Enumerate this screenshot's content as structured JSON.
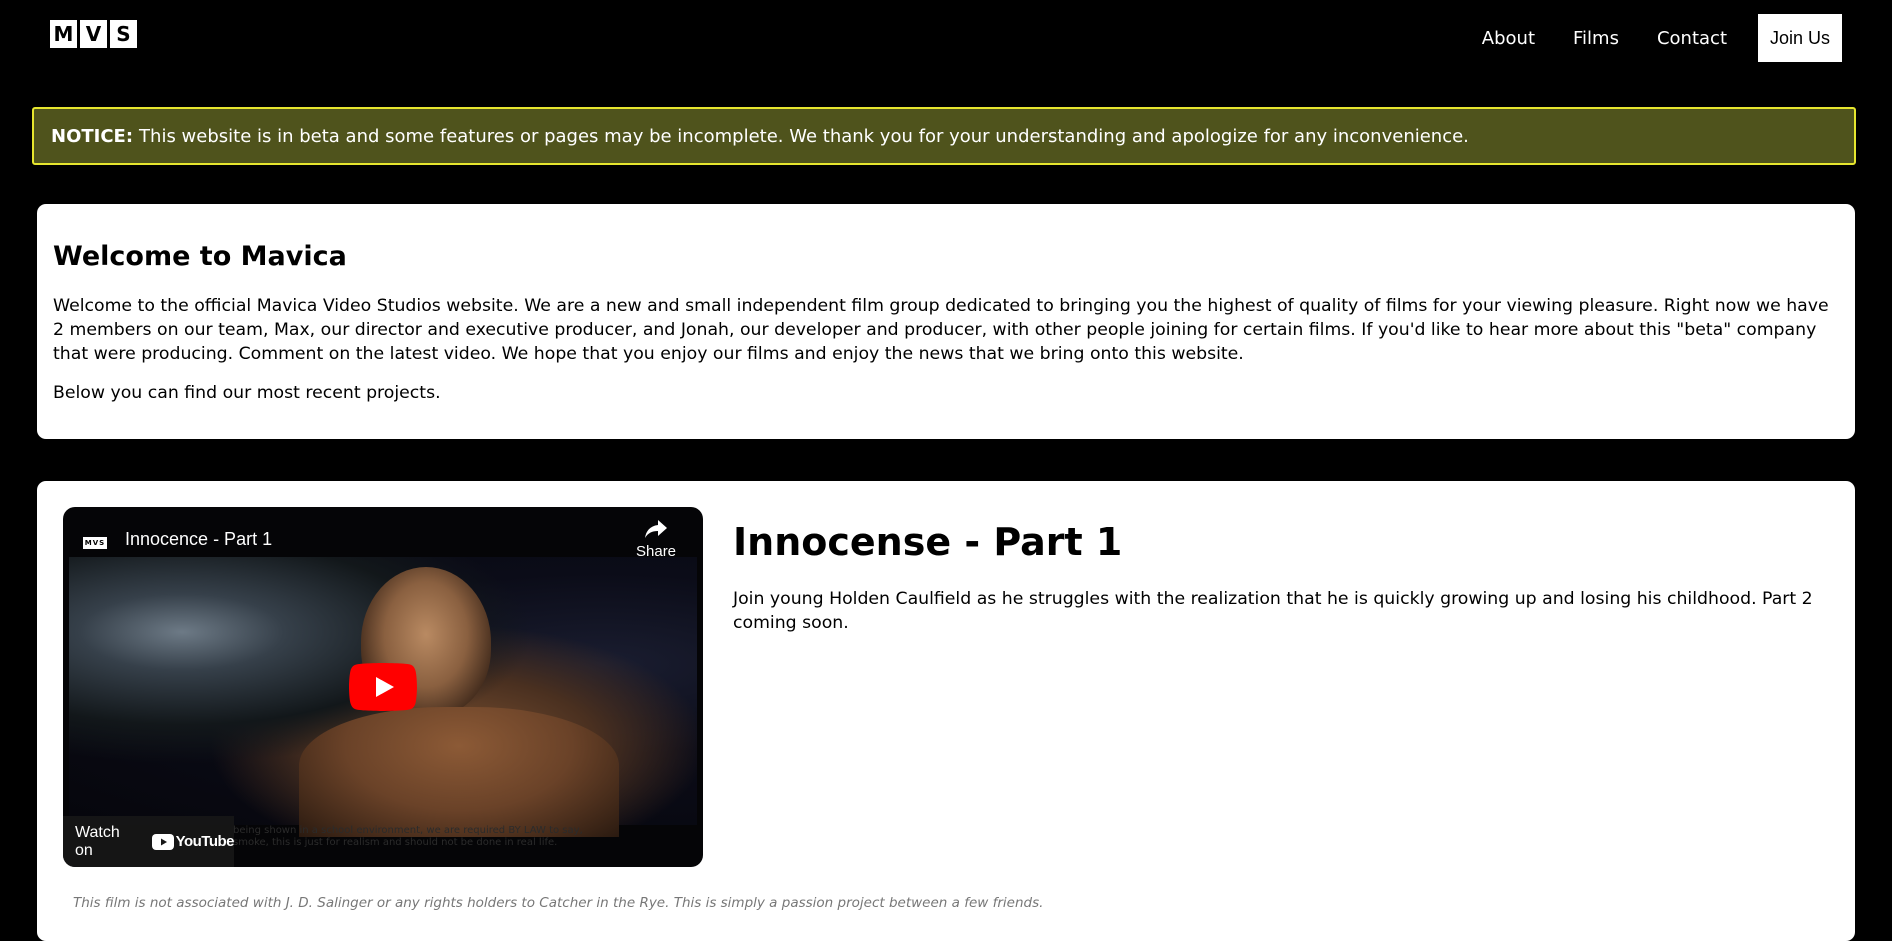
{
  "header": {
    "logo_letters": [
      "M",
      "V",
      "S"
    ],
    "nav": {
      "about": "About",
      "films": "Films",
      "contact": "Contact",
      "join": "Join Us"
    }
  },
  "notice": {
    "label": "NOTICE:",
    "text": "This website is in beta and some features or pages may be incomplete. We thank you for your understanding and apologize for any inconvenience.",
    "background_color": "#4f531c",
    "border_color": "#e6e62e"
  },
  "welcome": {
    "heading": "Welcome to Mavica",
    "paragraph1": "Welcome to the official Mavica Video Studios website. We are a new and small independent film group dedicated to bringing you the highest of quality of films for your viewing pleasure. Right now we have 2 members on our team, Max, our director and executive producer, and Jonah, our developer and producer, with other people joining for certain films. If you'd like to hear more about this \"beta\" company that were producing. Comment on the latest video. We hope that you enjoy our films and enjoy the news that we bring onto this website.",
    "paragraph2": "Below you can find our most recent projects."
  },
  "film": {
    "video": {
      "channel_logo": "MVS",
      "title": "Innocence - Part 1",
      "share_label": "Share",
      "watch_on_label": "Watch on",
      "youtube_label": "YouTube",
      "caption_line1": "being shown in a school environment, we are required BY LAW to say,",
      "caption_line2": "smoke, this is just for realism and should not be done in real life.",
      "play_button_color": "#ff0000"
    },
    "title": "Innocense - Part 1",
    "description": "Join young Holden Caulfield as he struggles with the realization that he is quickly growing up and losing his childhood. Part 2 coming soon.",
    "disclaimer": "This film is not associated with J. D. Salinger or any rights holders to Catcher in the Rye. This is simply a passion project between a few friends."
  }
}
